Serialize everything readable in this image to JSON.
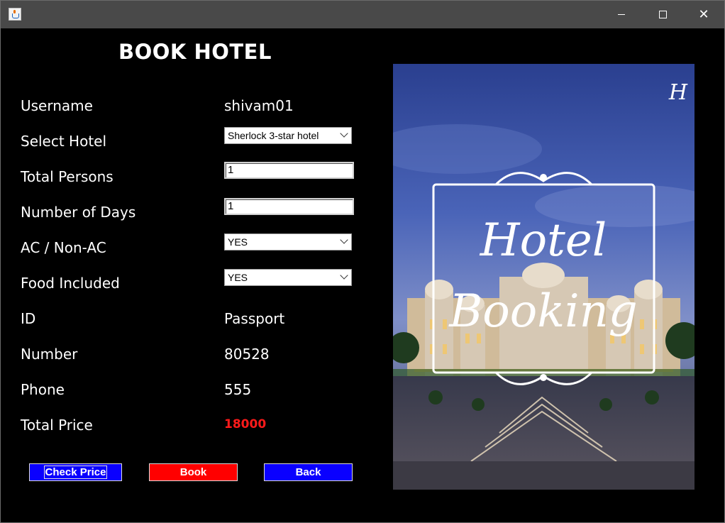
{
  "window": {
    "icon": "java-icon",
    "controls": {
      "minimize": "minimize-icon",
      "maximize": "maximize-icon",
      "close": "close-icon"
    }
  },
  "form": {
    "title": "BOOK HOTEL",
    "labels": {
      "username": "Username",
      "hotel": "Select Hotel",
      "persons": "Total Persons",
      "days": "Number of Days",
      "ac": "AC / Non-AC",
      "food": "Food Included",
      "id": "ID",
      "number": "Number",
      "phone": "Phone",
      "price": "Total Price"
    },
    "values": {
      "username": "shivam01",
      "hotel": "Sherlock 3-star hotel",
      "persons": "1",
      "days": "1",
      "ac": "YES",
      "food": "YES",
      "id": "Passport",
      "number": "80528",
      "phone": "555",
      "price": "18000"
    }
  },
  "buttons": {
    "check_price": "Check Price",
    "book": "Book",
    "back": "Back"
  },
  "image": {
    "line1": "Hotel",
    "line2": "Booking",
    "monogram": "H"
  },
  "colors": {
    "price": "#ff1a1a",
    "blue_button": "#0a00ff",
    "red_button": "#ff0000"
  }
}
